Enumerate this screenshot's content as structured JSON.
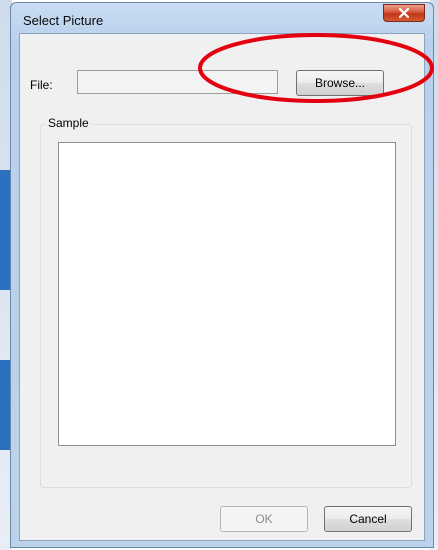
{
  "window": {
    "title": "Select Picture",
    "close_icon": "close-icon"
  },
  "file": {
    "label": "File:",
    "value": "",
    "placeholder": ""
  },
  "buttons": {
    "browse": "Browse...",
    "ok": "OK",
    "cancel": "Cancel"
  },
  "sample": {
    "label": "Sample"
  },
  "colors": {
    "highlight_ellipse": "#e3000f",
    "close_button": "#c9472a"
  }
}
